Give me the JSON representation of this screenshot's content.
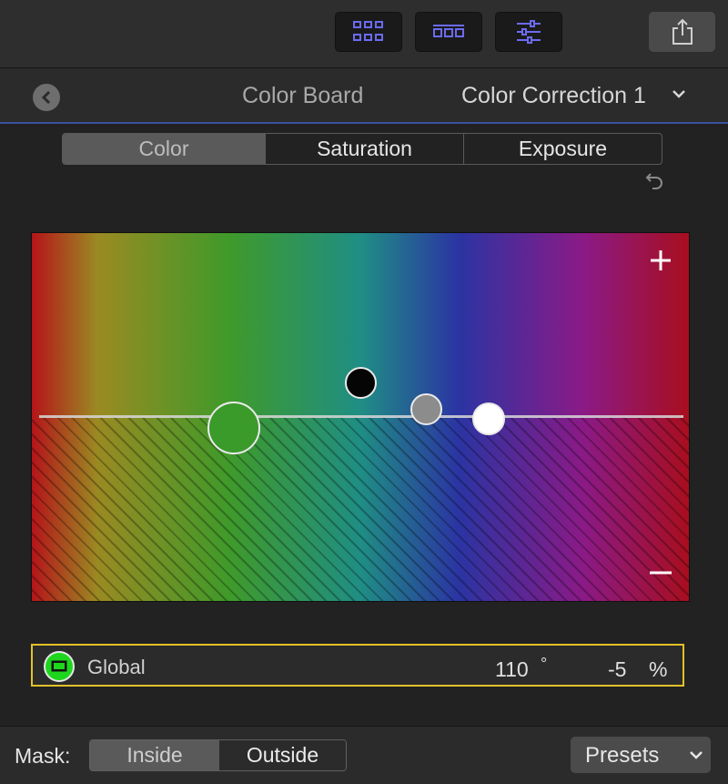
{
  "toolbar": {
    "buttons": [
      "grid-view",
      "filmstrip-view",
      "inspector-adjust"
    ],
    "share_icon": "share-icon",
    "accent": "#6b6bf2"
  },
  "header": {
    "title": "Color Board",
    "correction": "Color Correction 1"
  },
  "tabs": [
    {
      "label": "Color",
      "active": true
    },
    {
      "label": "Saturation",
      "active": false
    },
    {
      "label": "Exposure",
      "active": false
    }
  ],
  "board": {
    "plus_label": "+",
    "minus_label": "−"
  },
  "global": {
    "label": "Global",
    "angle": "110",
    "angle_unit": "°",
    "amount": "-5",
    "amount_unit": "%",
    "color": "#1ed61e"
  },
  "footer": {
    "mask_label": "Mask:",
    "inside_label": "Inside",
    "outside_label": "Outside",
    "presets_label": "Presets"
  }
}
